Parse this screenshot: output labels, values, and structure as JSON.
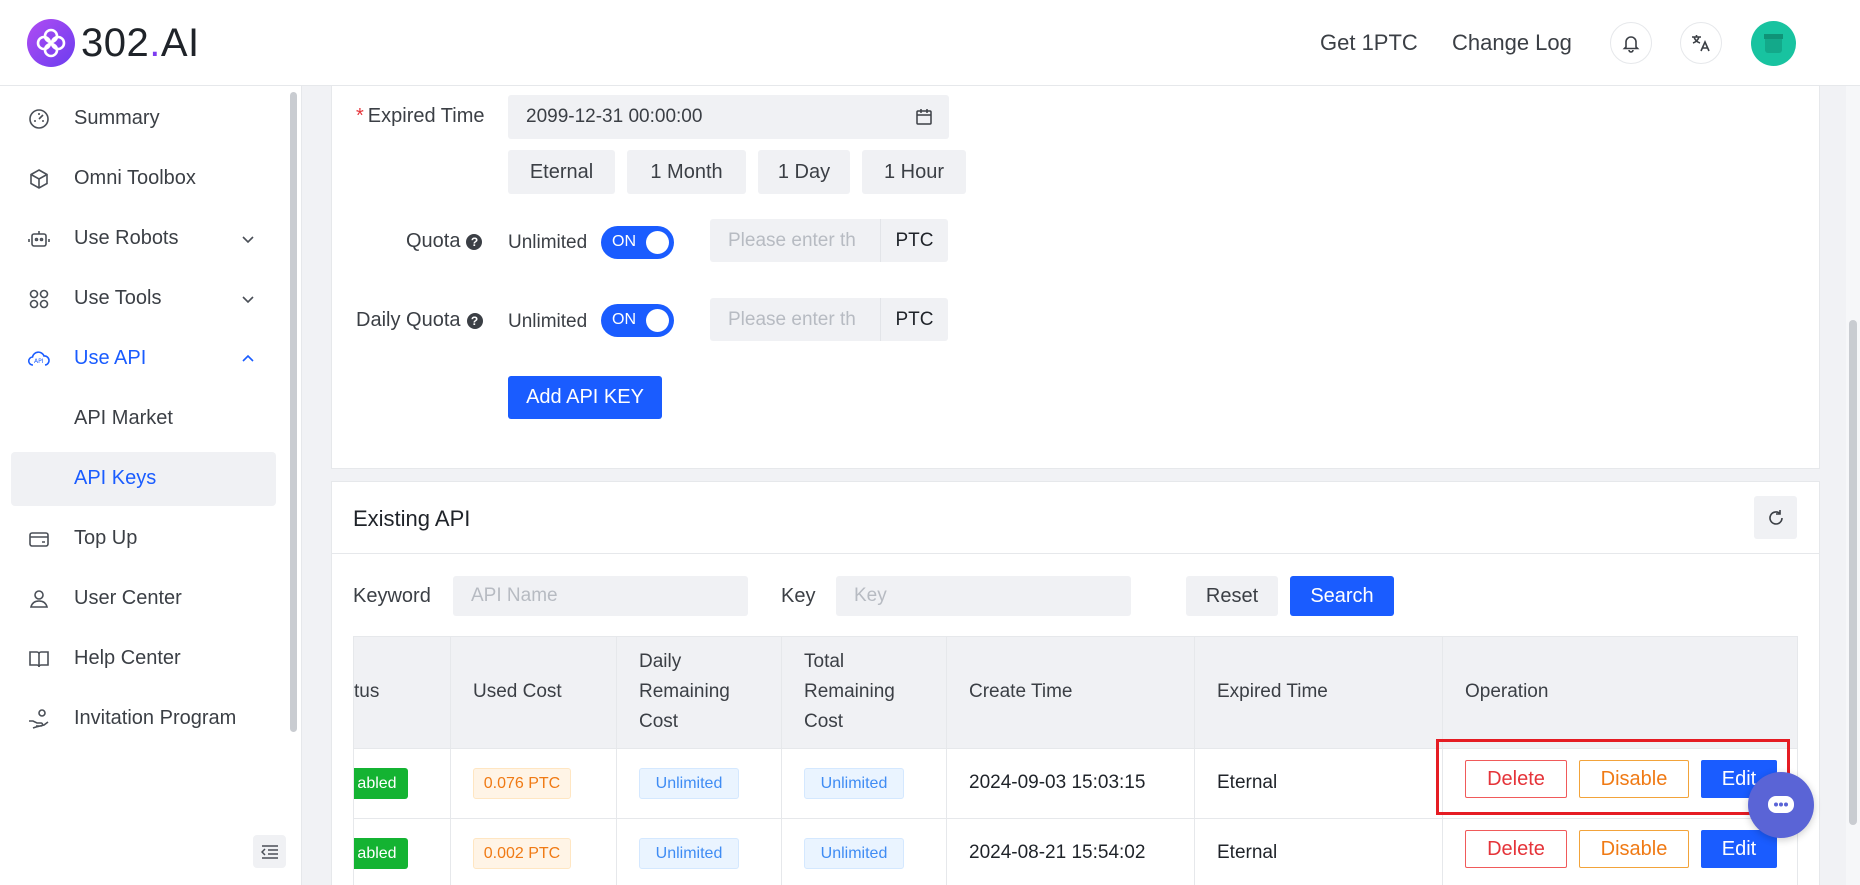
{
  "header": {
    "logo_text_a": "302",
    "logo_text_dot": ".",
    "logo_text_b": "AI",
    "link_get": "Get 1PTC",
    "link_changelog": "Change Log"
  },
  "sidebar": {
    "items": [
      {
        "label": "Summary"
      },
      {
        "label": "Omni Toolbox"
      },
      {
        "label": "Use Robots"
      },
      {
        "label": "Use Tools"
      },
      {
        "label": "Use API"
      },
      {
        "label": "API Market"
      },
      {
        "label": "API Keys"
      },
      {
        "label": "Top Up"
      },
      {
        "label": "User Center"
      },
      {
        "label": "Help Center"
      },
      {
        "label": "Invitation Program"
      }
    ]
  },
  "form": {
    "expired_label": "Expired Time",
    "required_mark": "*",
    "expired_value": "2099-12-31 00:00:00",
    "presets": [
      "Eternal",
      "1 Month",
      "1 Day",
      "1 Hour"
    ],
    "quota_label": "Quota",
    "daily_quota_label": "Daily Quota",
    "help_glyph": "?",
    "unlimited_label": "Unlimited",
    "toggle_on": "ON",
    "quota_placeholder": "Please enter th",
    "unit": "PTC",
    "add_button": "Add API KEY"
  },
  "existing": {
    "title": "Existing API",
    "keyword_label": "Keyword",
    "keyword_placeholder": "API Name",
    "key_label": "Key",
    "key_placeholder": "Key",
    "reset_button": "Reset",
    "search_button": "Search",
    "columns": {
      "status": "tus",
      "used_cost": "Used Cost",
      "daily_1": "Daily",
      "daily_2": "Remaining",
      "daily_3": "Cost",
      "total_1": "Total",
      "total_2": "Remaining",
      "total_3": "Cost",
      "create_time": "Create Time",
      "expired_time": "Expired Time",
      "operation": "Operation"
    },
    "rows": [
      {
        "status": "abled",
        "used_cost": "0.076 PTC",
        "daily": "Unlimited",
        "total": "Unlimited",
        "create_time": "2024-09-03 15:03:15",
        "expired": "Eternal"
      },
      {
        "status": "abled",
        "used_cost": "0.002 PTC",
        "daily": "Unlimited",
        "total": "Unlimited",
        "create_time": "2024-08-21 15:54:02",
        "expired": "Eternal"
      }
    ],
    "ops": {
      "delete": "Delete",
      "disable": "Disable",
      "edit": "Edit"
    }
  },
  "colors": {
    "accent": "#1a5cff",
    "danger": "#e5343a",
    "warning": "#f07a14",
    "success": "#14b332"
  }
}
